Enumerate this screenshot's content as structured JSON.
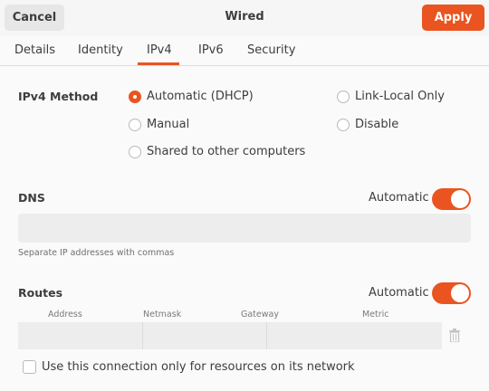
{
  "header": {
    "cancel_label": "Cancel",
    "title": "Wired",
    "apply_label": "Apply"
  },
  "tabs": [
    {
      "label": "Details",
      "active": false
    },
    {
      "label": "Identity",
      "active": false
    },
    {
      "label": "IPv4",
      "active": true
    },
    {
      "label": "IPv6",
      "active": false
    },
    {
      "label": "Security",
      "active": false
    }
  ],
  "ipv4_method": {
    "label": "IPv4 Method",
    "options": [
      {
        "label": "Automatic (DHCP)",
        "selected": true
      },
      {
        "label": "Link-Local Only",
        "selected": false
      },
      {
        "label": "Manual",
        "selected": false
      },
      {
        "label": "Disable",
        "selected": false
      },
      {
        "label": "Shared to other computers",
        "selected": false
      }
    ]
  },
  "dns": {
    "label": "DNS",
    "automatic_label": "Automatic",
    "automatic_on": true,
    "value": "",
    "hint": "Separate IP addresses with commas"
  },
  "routes": {
    "label": "Routes",
    "automatic_label": "Automatic",
    "automatic_on": true,
    "columns": [
      "Address",
      "Netmask",
      "Gateway",
      "Metric"
    ],
    "rows": [
      {
        "address": "",
        "netmask": "",
        "gateway": "",
        "metric": ""
      }
    ]
  },
  "only_resources": {
    "label": "Use this connection only for resources on its network",
    "checked": false
  },
  "colors": {
    "accent": "#e95420",
    "background": "#fafafa",
    "entry": "#ededed"
  },
  "icons": {
    "delete_route": "trash-icon"
  }
}
